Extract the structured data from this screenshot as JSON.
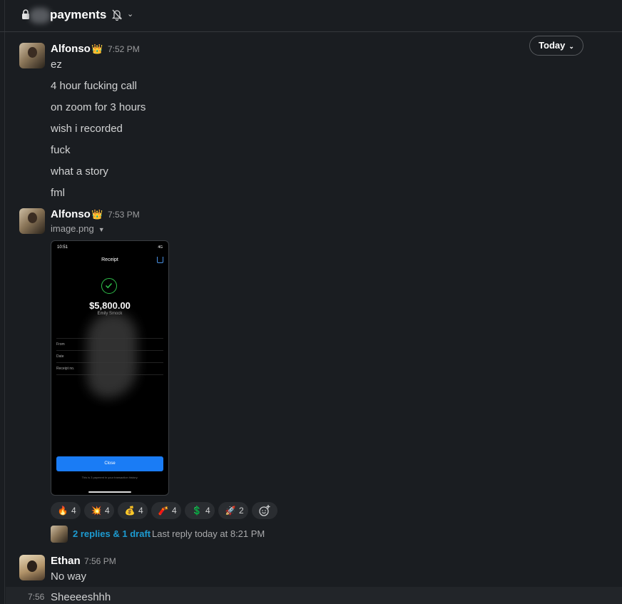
{
  "header": {
    "channel_name": "payments",
    "lock_icon": "lock-icon",
    "bell_icon": "bell-off-icon",
    "chevron_icon": "chevron-down-icon"
  },
  "date_divider": {
    "label": "Today"
  },
  "messages": [
    {
      "author": "Alfonso",
      "badge": "👑",
      "time": "7:52 PM",
      "lines": [
        "ez",
        "4 hour fucking call",
        "on zoom for 3 hours",
        "wish i recorded",
        "fuck",
        "what a story",
        "fml"
      ]
    },
    {
      "author": "Alfonso",
      "badge": "👑",
      "time": "7:53 PM",
      "attachment": {
        "file_name": "image.png",
        "phone_time": "10:51",
        "phone_status": "4G",
        "title": "Receipt",
        "amount": "$5,800.00",
        "subtitle": "Emily Smock",
        "fields": [
          "From",
          "Date",
          "Receipt no."
        ],
        "button": "Close",
        "footer": "This is 3 payment in your transaction history."
      },
      "reactions": [
        {
          "emoji": "🔥",
          "count": "4"
        },
        {
          "emoji": "💥",
          "count": "4"
        },
        {
          "emoji": "💰",
          "count": "4"
        },
        {
          "emoji": "🧨",
          "count": "4"
        },
        {
          "emoji": "💲",
          "count": "4"
        },
        {
          "emoji": "🚀",
          "count": "2"
        }
      ],
      "thread": {
        "replies": "2 replies & 1 draft",
        "last_reply": "Last reply today at 8:21 PM"
      }
    },
    {
      "author": "Ethan",
      "time": "7:56 PM",
      "lines": [
        "No way"
      ]
    },
    {
      "compact_time": "7:56",
      "lines": [
        "Sheeeeshhh"
      ]
    }
  ],
  "colors": {
    "background": "#1a1d21",
    "link": "#1d9bd1",
    "pay_button": "#1a7cf5",
    "check": "#2fbf4a"
  }
}
